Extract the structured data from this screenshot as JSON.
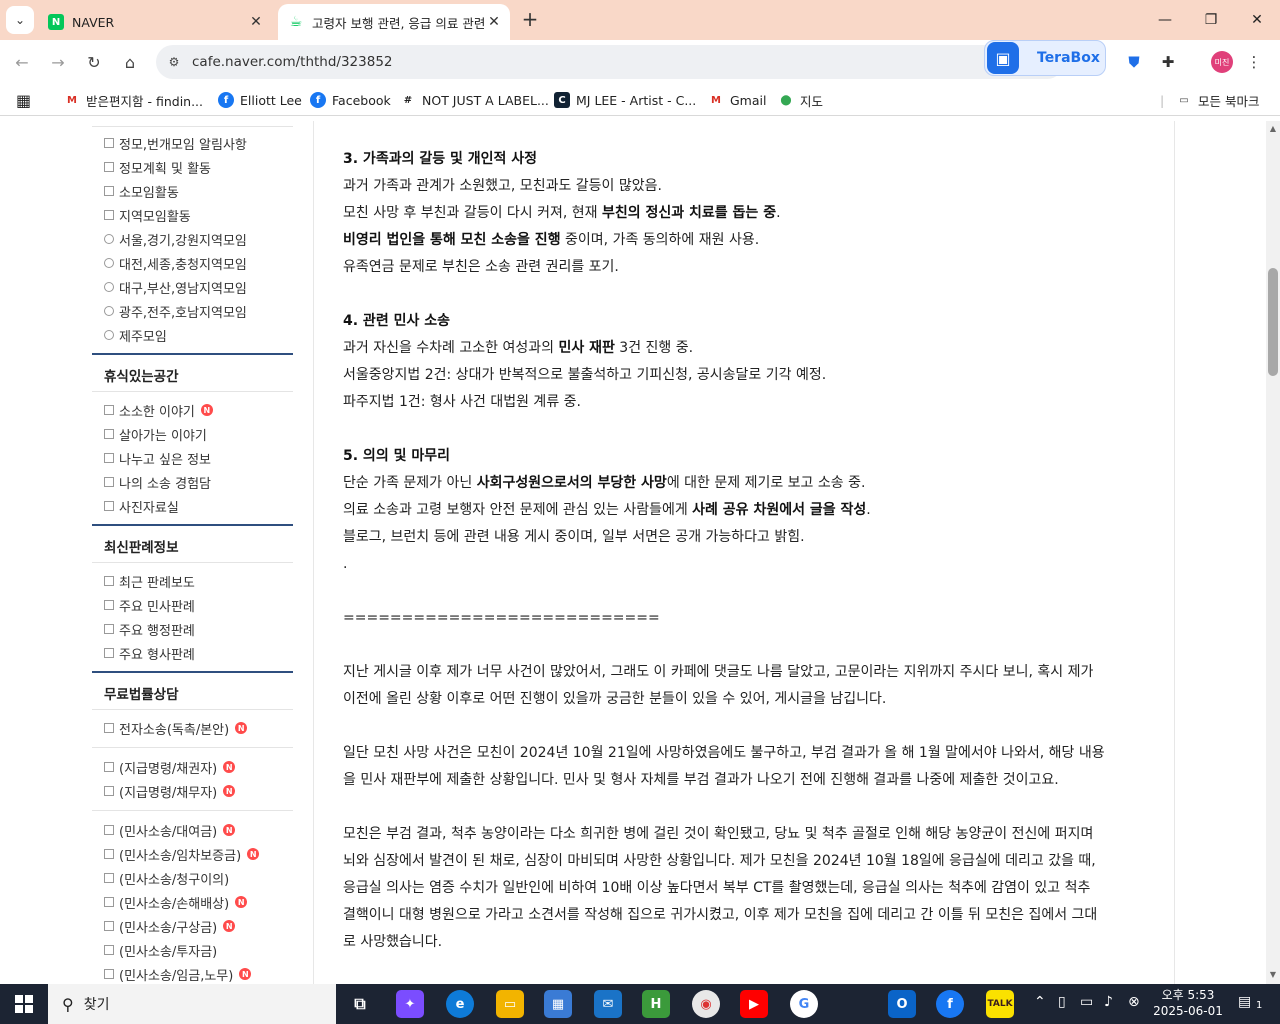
{
  "browser": {
    "tabs": [
      {
        "title": "NAVER",
        "active": false
      },
      {
        "title": "고령자 보행 관련, 응급 의료 관련 ...",
        "active": true
      }
    ],
    "url": "cafe.naver.com/ththd/323852",
    "terabox_label": "TeraBox",
    "profile_label": "미진",
    "bookmarks": [
      "받은편지함 - findin...",
      "Elliott Lee",
      "Facebook",
      "NOT JUST A LABEL...",
      "MJ LEE - Artist - C...",
      "Gmail",
      "지도"
    ],
    "all_bookmarks": "모든 북마크"
  },
  "sidebar": {
    "items_top": [
      {
        "label": "정모,번개모임 알림사항",
        "icon": "board-icon"
      },
      {
        "label": "정모계획 및 활동",
        "icon": "board-icon"
      },
      {
        "label": "소모임활동",
        "icon": "board-icon"
      },
      {
        "label": "지역모임활동",
        "icon": "board-icon"
      },
      {
        "label": "서울,경기,강원지역모임",
        "icon": "location-icon"
      },
      {
        "label": "대전,세종,충청지역모임",
        "icon": "location-icon"
      },
      {
        "label": "대구,부산,영남지역모임",
        "icon": "location-icon"
      },
      {
        "label": "광주,전주,호남지역모임",
        "icon": "location-icon"
      },
      {
        "label": "제주모임",
        "icon": "location-icon"
      }
    ],
    "heading_rest": "휴식있는공간",
    "items_rest": [
      {
        "label": "소소한 이야기",
        "new": true
      },
      {
        "label": "살아가는 이야기",
        "new": false
      },
      {
        "label": "나누고 싶은 정보",
        "new": false
      },
      {
        "label": "나의 소송 경험담",
        "new": false
      },
      {
        "label": "사진자료실",
        "new": false
      }
    ],
    "heading_precedent": "최신판례정보",
    "items_precedent": [
      {
        "label": "최근 판례보도"
      },
      {
        "label": "주요 민사판례"
      },
      {
        "label": "주요 행정판례"
      },
      {
        "label": "주요 형사판례"
      }
    ],
    "heading_consult": "무료법률상담",
    "items_consult_1": [
      {
        "label": "전자소송(독촉/본안)",
        "new": true
      }
    ],
    "items_consult_2": [
      {
        "label": "(지급명령/채권자)",
        "new": true
      },
      {
        "label": "(지급명령/채무자)",
        "new": true
      }
    ],
    "items_consult_3": [
      {
        "label": "(민사소송/대여금)",
        "new": true
      },
      {
        "label": "(민사소송/임차보증금)",
        "new": true
      },
      {
        "label": "(민사소송/청구이의)",
        "new": false
      },
      {
        "label": "(민사소송/손해배상)",
        "new": true
      },
      {
        "label": "(민사소송/구상금)",
        "new": true
      },
      {
        "label": "(민사소송/투자금)",
        "new": false
      },
      {
        "label": "(민사소송/임금,노무)",
        "new": true
      }
    ],
    "badge_letter": "N"
  },
  "article": {
    "s3_title": "3. 가족과의 갈등 및 개인적 사정",
    "s3_l1": "과거 가족과 관계가 소원했고, 모친과도 갈등이 많았음.",
    "s3_l2a": "모친 사망 후 부친과 갈등이 다시 커져, 현재 ",
    "s3_l2b": "부친의 정신과 치료를 돕는 중",
    "s3_l2c": ".",
    "s3_l3a": "비영리 법인을 통해 모친 소송을 진행",
    "s3_l3b": " 중이며, 가족 동의하에 재원 사용.",
    "s3_l4": "유족연금 문제로 부친은 소송 관련 권리를 포기.",
    "s4_title": "4. 관련 민사 소송",
    "s4_l1a": "과거 자신을 수차례 고소한 여성과의 ",
    "s4_l1b": "민사 재판",
    "s4_l1c": " 3건 진행 중.",
    "s4_l2": "서울중앙지법 2건: 상대가 반복적으로 불출석하고 기피신청, 공시송달로 기각 예정.",
    "s4_l3": "파주지법 1건: 형사 사건 대법원 계류 중.",
    "s5_title": "5. 의의 및 마무리",
    "s5_l1a": "단순 가족 문제가 아닌 ",
    "s5_l1b": "사회구성원으로서의 부당한 사망",
    "s5_l1c": "에 대한 문제 제기로 보고 소송 중.",
    "s5_l2a": "의료 소송과 고령 보행자 안전 문제에 관심 있는 사람들에게 ",
    "s5_l2b": "사례 공유 차원에서 글을 작성",
    "s5_l2c": ".",
    "s5_l3": "블로그, 브런치 등에 관련 내용 게시 중이며, 일부 서면은 공개 가능하다고 밝힘.",
    "dot": ".",
    "separator": "===========================",
    "p1_l1": "지난 게시글 이후 제가 너무 사건이 많았어서, 그래도 이 카페에 댓글도 나름 달았고, 고문이라는 지위까지 주시다 보니, 혹시 제가",
    "p1_l2": "이전에 올린 상황 이후로 어떤 진행이 있을까 궁금한 분들이 있을 수 있어, 게시글을 남깁니다.",
    "p2_l1": "일단 모친 사망 사건은 모친이 2024년 10월 21일에 사망하였음에도 불구하고, 부검 결과가 올 해 1월 말에서야 나와서, 해당 내용",
    "p2_l2": "을 민사 재판부에 제출한 상황입니다. 민사 및 형사 자체를 부검 결과가 나오기 전에 진행해 결과를 나중에 제출한 것이고요.",
    "p3_l1": "모친은 부검 결과, 척추 농양이라는 다소 희귀한 병에 걸린 것이 확인됐고, 당뇨 및 척추 골절로 인해 해당 농양균이 전신에 퍼지며",
    "p3_l2": "뇌와 심장에서 발견이 된 채로, 심장이 마비되며 사망한 상황입니다. 제가 모친을 2024년 10월 18일에 응급실에 데리고 갔을 때,",
    "p3_l3": "응급실 의사는 염증 수치가 일반인에 비하여 10배 이상 높다면서 복부 CT를 촬영했는데, 응급실 의사는 척추에 감염이 있고 척추",
    "p3_l4": "결핵이니 대형 병원으로 가라고 소견서를 작성해 집으로 귀가시켰고, 이후 제가 모친을 집에 데리고 간 이틀 뒤 모친은 집에서 그대",
    "p3_l5": "로 사망했습니다."
  },
  "taskbar": {
    "search_placeholder": "찾기",
    "time": "오후 5:53",
    "date": "2025-06-01",
    "notification_count": "1"
  },
  "colors": {
    "tabstrip": "#f9d8c8",
    "sidebar_rule": "#2f4f7f",
    "new_badge": "#ff4b4b",
    "taskbar": "#1c2433"
  }
}
